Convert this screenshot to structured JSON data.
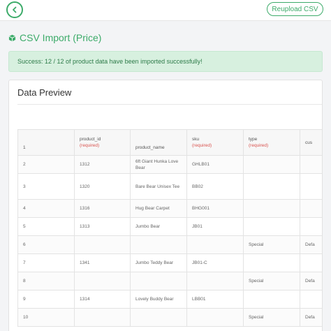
{
  "header": {
    "back_icon": "chevron-left-icon",
    "reupload_label": "Reupload CSV"
  },
  "page": {
    "title": "CSV Import (Price)",
    "title_icon": "cube-icon",
    "accent_color": "#3dab6a"
  },
  "alert": {
    "message": "Success: 12 / 12 of product data have been imported successfully!"
  },
  "preview": {
    "title": "Data Preview",
    "columns": [
      {
        "name": "",
        "required": ""
      },
      {
        "name": "product_id",
        "required": "(required)"
      },
      {
        "name": "product_name",
        "required": ""
      },
      {
        "name": "sku",
        "required": "(required)"
      },
      {
        "name": "type",
        "required": "(required)"
      },
      {
        "name": "cus",
        "required": ""
      }
    ],
    "rows": [
      {
        "row": "1",
        "product_id": "",
        "product_name": "",
        "sku": "",
        "type": "",
        "cus": ""
      },
      {
        "row": "2",
        "product_id": "1312",
        "product_name": "6ft Giant Hunka Love Bear",
        "sku": "GHLB01",
        "type": "",
        "cus": ""
      },
      {
        "row": "3",
        "product_id": "1320",
        "product_name": "Bare Bear Unisex Tee",
        "sku": "BB02",
        "type": "",
        "cus": ""
      },
      {
        "row": "4",
        "product_id": "1316",
        "product_name": "Hug Bear Carpet",
        "sku": "BHG001",
        "type": "",
        "cus": ""
      },
      {
        "row": "5",
        "product_id": "1313",
        "product_name": "Jumbo Bear",
        "sku": "JB01",
        "type": "",
        "cus": ""
      },
      {
        "row": "6",
        "product_id": "",
        "product_name": "",
        "sku": "",
        "type": "Special",
        "cus": "Defa"
      },
      {
        "row": "7",
        "product_id": "1341",
        "product_name": "Jumbo Teddy Bear",
        "sku": "JB01-C",
        "type": "",
        "cus": ""
      },
      {
        "row": "8",
        "product_id": "",
        "product_name": "",
        "sku": "",
        "type": "Special",
        "cus": "Defa"
      },
      {
        "row": "9",
        "product_id": "1314",
        "product_name": "Lovely Buddy Bear",
        "sku": "LBB01",
        "type": "",
        "cus": ""
      },
      {
        "row": "10",
        "product_id": "",
        "product_name": "",
        "sku": "",
        "type": "Special",
        "cus": "Defa"
      }
    ]
  }
}
